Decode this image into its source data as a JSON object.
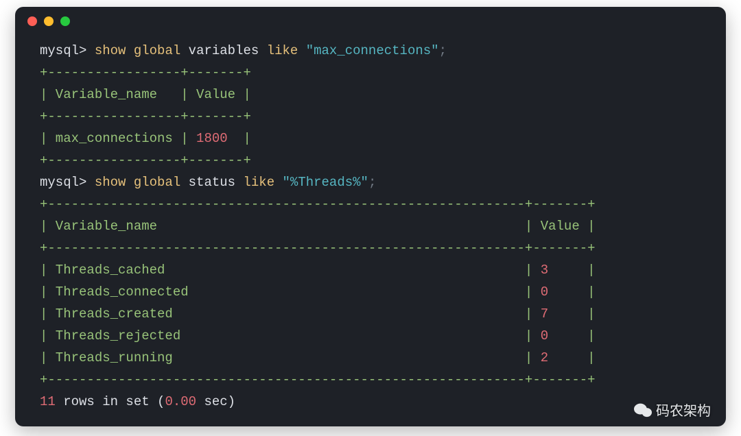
{
  "traffic_lights": [
    "close",
    "minimize",
    "zoom"
  ],
  "prompt": "mysql>",
  "queries": [
    {
      "verb_a": "show",
      "verb_b": "global",
      "verb_c": "variables",
      "verb_d": "like",
      "arg": "\"max_connections\"",
      "term": ";",
      "border_top": "+-----------------+-------+",
      "header_row": "| Variable_name   | Value |",
      "border_mid": "+-----------------+-------+",
      "rows": [
        {
          "name": "max_connections",
          "value": "1800",
          "raw": "| max_connections | 1800  |",
          "name_pad": "| max_connections | ",
          "val_pad": "  |"
        }
      ],
      "border_bot": "+-----------------+-------+"
    },
    {
      "verb_a": "show",
      "verb_b": "global",
      "verb_c": "status",
      "verb_d": "like",
      "arg": "\"%Threads%\"",
      "term": ";",
      "border_top": "+-------------------------------------------------------------+-------+",
      "header_row": "| Variable_name                                               | Value |",
      "border_mid": "+-------------------------------------------------------------+-------+",
      "rows": [
        {
          "name": "Threads_cached",
          "value": "3",
          "name_pad": "| Threads_cached                                              | ",
          "val_pad": "     |"
        },
        {
          "name": "Threads_connected",
          "value": "0",
          "name_pad": "| Threads_connected                                           | ",
          "val_pad": "     |"
        },
        {
          "name": "Threads_created",
          "value": "7",
          "name_pad": "| Threads_created                                             | ",
          "val_pad": "     |"
        },
        {
          "name": "Threads_rejected",
          "value": "0",
          "name_pad": "| Threads_rejected                                            | ",
          "val_pad": "     |"
        },
        {
          "name": "Threads_running",
          "value": "2",
          "name_pad": "| Threads_running                                             | ",
          "val_pad": "     |"
        }
      ],
      "border_bot": "+-------------------------------------------------------------+-------+"
    }
  ],
  "footer": {
    "rows": "11",
    "mid": " rows in set (",
    "secs": "0.00",
    "tail": " sec)"
  },
  "watermark": "码农架构"
}
